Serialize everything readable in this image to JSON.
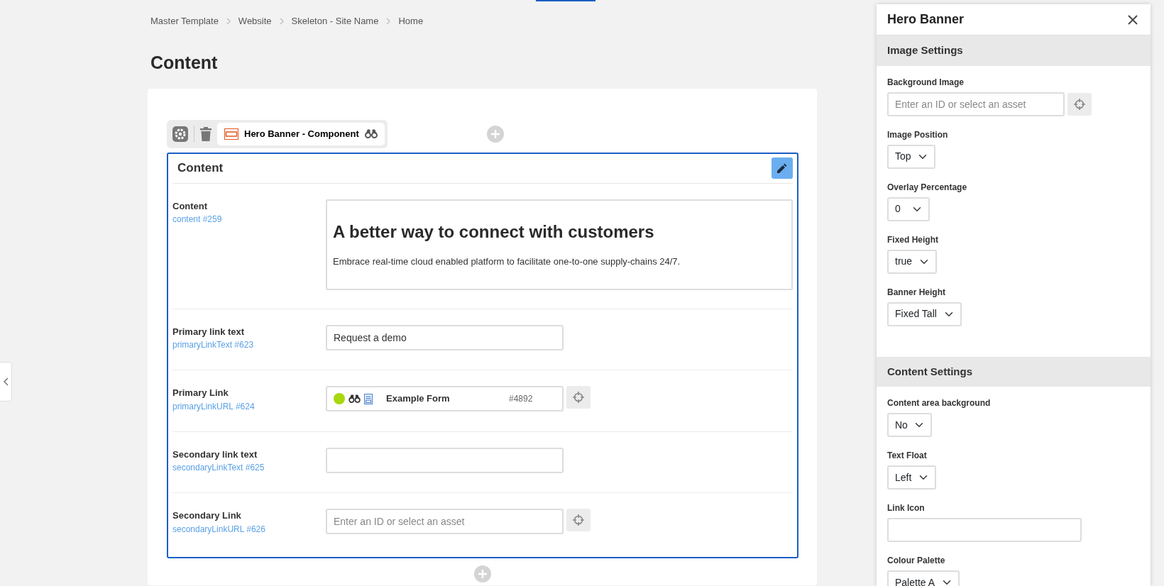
{
  "breadcrumb": [
    "Master Template",
    "Website",
    "Skeleton - Site Name",
    "Home"
  ],
  "page_title": "Content",
  "component": {
    "label": "Hero Banner - Component"
  },
  "editor": {
    "title": "Content",
    "fields": [
      {
        "kind": "richtext",
        "label": "Content",
        "ref": "content #259",
        "heading": "A better way to connect with customers",
        "body": "Embrace real-time cloud enabled platform to facilitate one-to-one supply-chains 24/7."
      },
      {
        "kind": "text",
        "label": "Primary link text",
        "ref": "primaryLinkText #623",
        "value": "Request a demo"
      },
      {
        "kind": "asset",
        "label": "Primary Link",
        "ref": "primaryLinkURL #624",
        "asset_name": "Example Form",
        "asset_id": "#4892"
      },
      {
        "kind": "text",
        "label": "Secondary link text",
        "ref": "secondaryLinkText #625"
      },
      {
        "kind": "asset",
        "label": "Secondary Link",
        "ref": "secondaryLinkURL #626",
        "placeholder": "Enter an ID or select an asset"
      }
    ]
  },
  "drawer": {
    "title": "Hero Banner",
    "sections": [
      {
        "title": "Image Settings",
        "fields": [
          {
            "kind": "asset",
            "label": "Background Image",
            "placeholder": "Enter an ID or select an asset"
          },
          {
            "kind": "select",
            "label": "Image Position",
            "value": "Top"
          },
          {
            "kind": "select",
            "label": "Overlay Percentage",
            "value": "0"
          },
          {
            "kind": "select",
            "label": "Fixed Height",
            "value": "true"
          },
          {
            "kind": "select",
            "label": "Banner Height",
            "value": "Fixed Tall"
          }
        ]
      },
      {
        "title": "Content Settings",
        "fields": [
          {
            "kind": "select",
            "label": "Content area background",
            "value": "No"
          },
          {
            "kind": "select",
            "label": "Text Float",
            "value": "Left"
          },
          {
            "kind": "text",
            "label": "Link Icon"
          },
          {
            "kind": "select",
            "label": "Colour Palette",
            "value": "Palette A"
          }
        ]
      }
    ]
  }
}
